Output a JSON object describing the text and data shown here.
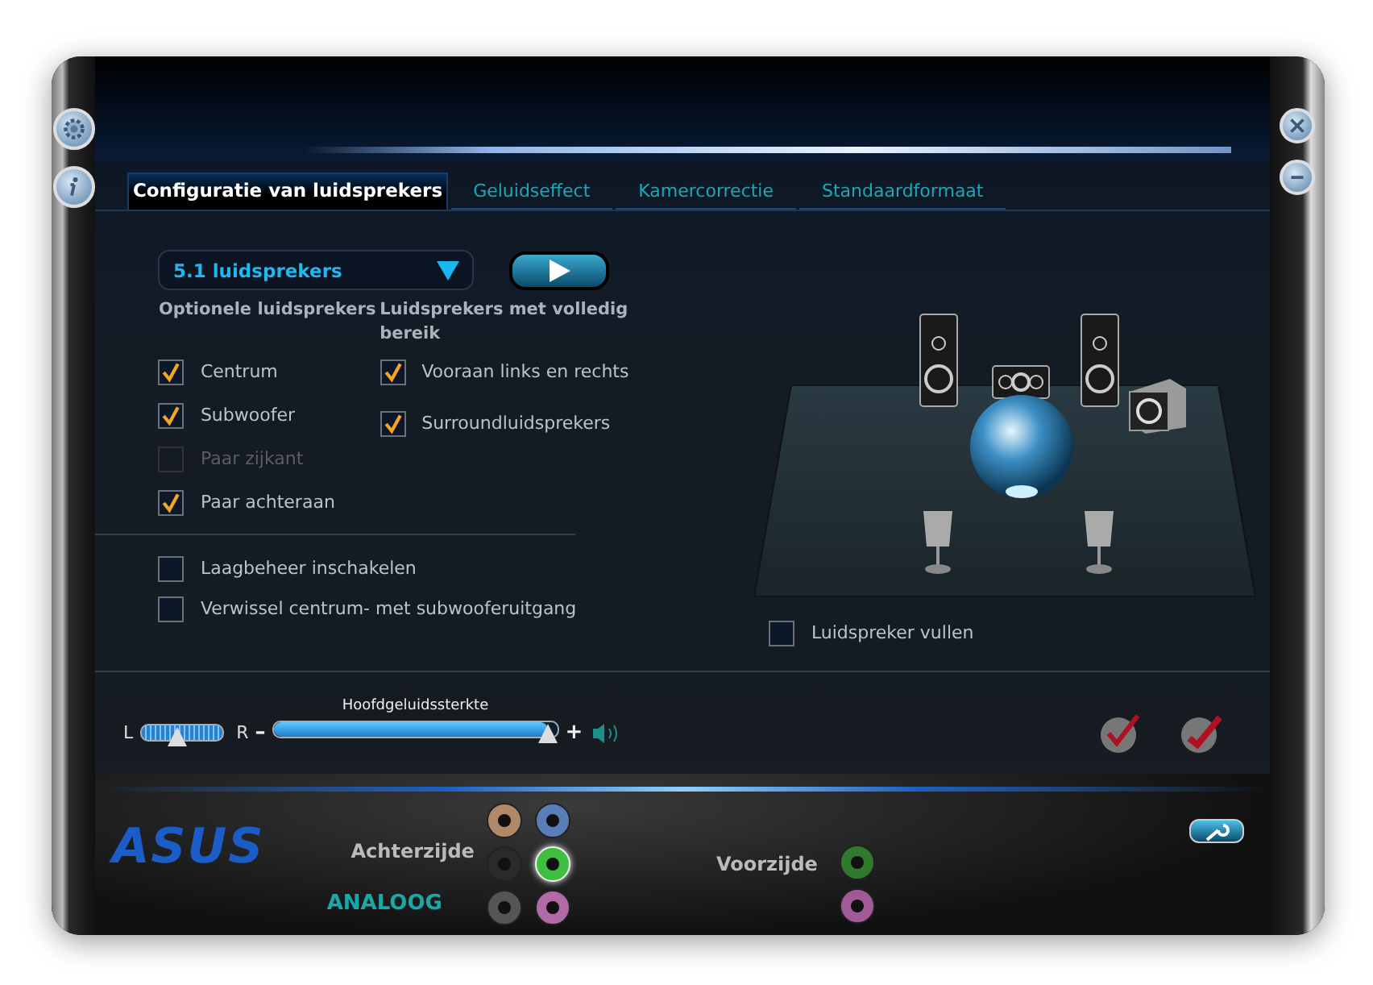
{
  "tabs": [
    {
      "label": "Configuratie van luidsprekers",
      "selected": true
    },
    {
      "label": "Geluidseffect",
      "selected": false
    },
    {
      "label": "Kamercorrectie",
      "selected": false
    },
    {
      "label": "Standaardformaat",
      "selected": false
    }
  ],
  "speaker_dropdown": {
    "value": "5.1 luidsprekers"
  },
  "optional_speakers": {
    "heading": "Optionele luidsprekers",
    "items": [
      {
        "label": "Centrum",
        "checked": true,
        "disabled": false
      },
      {
        "label": "Subwoofer",
        "checked": true,
        "disabled": false
      },
      {
        "label": "Paar zijkant",
        "checked": false,
        "disabled": true
      },
      {
        "label": "Paar achteraan",
        "checked": true,
        "disabled": false
      }
    ]
  },
  "full_range_speakers": {
    "heading": "Luidsprekers met volledig bereik",
    "items": [
      {
        "label": "Vooraan links en rechts",
        "checked": true,
        "disabled": false
      },
      {
        "label": "Surroundluidsprekers",
        "checked": true,
        "disabled": false
      }
    ]
  },
  "options": [
    {
      "label": "Laagbeheer inschakelen",
      "checked": false
    },
    {
      "label": "Verwissel centrum- met subwooferuitgang",
      "checked": false
    }
  ],
  "fill_speaker": {
    "label": "Luidspreker vullen",
    "checked": false
  },
  "balance": {
    "left_label": "L",
    "right_label": "R",
    "level": 0.45
  },
  "volume": {
    "label": "Hoofdgeluidssterkte",
    "minus": "–",
    "plus": "+",
    "level": 0.97
  },
  "logo": "ASUS",
  "rear_panel": {
    "label": "Achterzijde",
    "jacks": [
      {
        "color": "#b08a68",
        "connected": false
      },
      {
        "color": "#5a7fb8",
        "connected": false
      },
      {
        "color": "#2a2a2a",
        "connected": false
      },
      {
        "color": "#3fbf3f",
        "connected": true
      },
      {
        "color": "#555555",
        "connected": false
      },
      {
        "color": "#b06aa6",
        "connected": false
      }
    ]
  },
  "front_panel": {
    "label": "Voorzijde",
    "jacks": [
      {
        "color": "#2f7a2f",
        "connected": false
      },
      {
        "color": "#a05a98",
        "connected": false
      }
    ]
  },
  "mode_label": "ANALOOG"
}
